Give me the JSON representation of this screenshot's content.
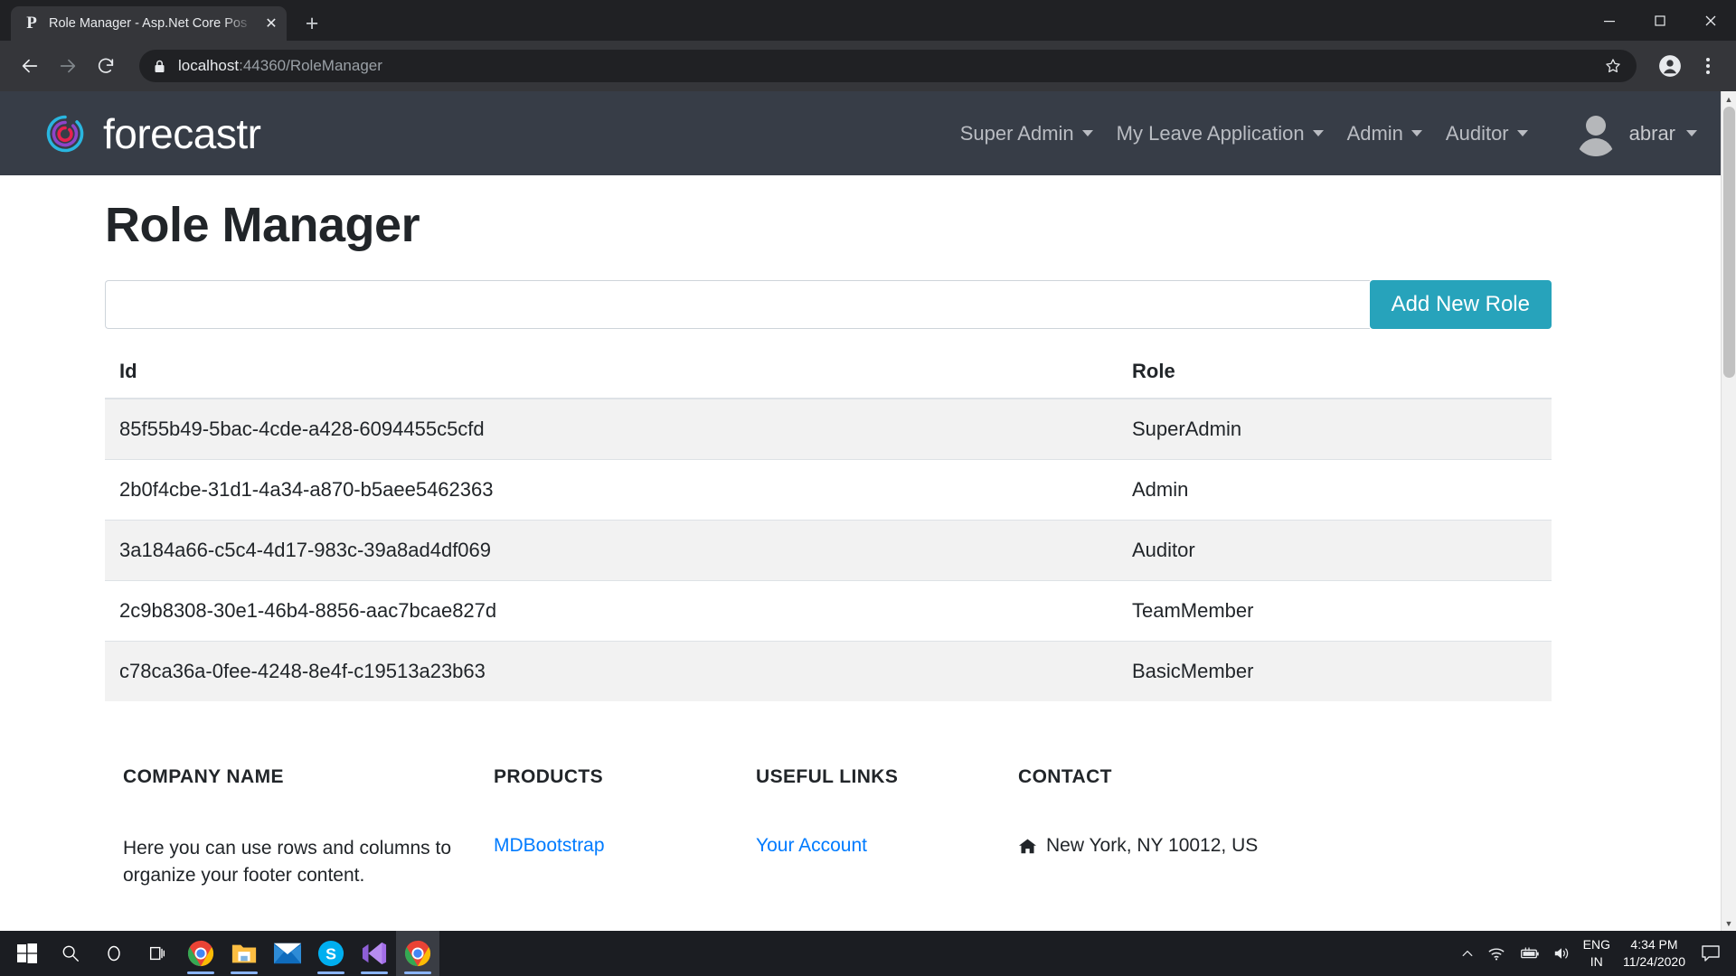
{
  "browser": {
    "tab": {
      "favicon": "P",
      "title": "Role Manager - Asp.Net Core Pos",
      "close_label": "✕"
    },
    "new_tab_label": "+",
    "window_controls": {
      "minimize": "minimize-icon",
      "maximize": "maximize-icon",
      "close": "close-icon"
    },
    "toolbar": {
      "back": "back-arrow-icon",
      "forward": "forward-arrow-icon",
      "reload": "reload-icon",
      "lock": "lock-icon",
      "url_host": "localhost",
      "url_rest": ":44360/RoleManager",
      "bookmark": "star-icon",
      "profile": "profile-avatar-icon",
      "menu": "three-dots-menu-icon"
    }
  },
  "site": {
    "brand": "forecastr",
    "nav_items": [
      {
        "label": "Super Admin"
      },
      {
        "label": "My Leave Application"
      },
      {
        "label": "Admin"
      },
      {
        "label": "Auditor"
      }
    ],
    "user": {
      "name": "abrar"
    }
  },
  "main": {
    "title": "Role Manager",
    "input": {
      "value": "",
      "placeholder": ""
    },
    "add_button": "Add New Role",
    "table": {
      "columns": [
        "Id",
        "Role"
      ],
      "rows": [
        {
          "id": "85f55b49-5bac-4cde-a428-6094455c5cfd",
          "role": "SuperAdmin"
        },
        {
          "id": "2b0f4cbe-31d1-4a34-a870-b5aee5462363",
          "role": "Admin"
        },
        {
          "id": "3a184a66-c5c4-4d17-983c-39a8ad4df069",
          "role": "Auditor"
        },
        {
          "id": "2c9b8308-30e1-46b4-8856-aac7bcae827d",
          "role": "TeamMember"
        },
        {
          "id": "c78ca36a-0fee-4248-8e4f-c19513a23b63",
          "role": "BasicMember"
        }
      ]
    }
  },
  "footer": {
    "company": {
      "heading": "COMPANY NAME",
      "text": "Here you can use rows and columns to organize your footer content."
    },
    "products": {
      "heading": "PRODUCTS",
      "links": [
        "MDBootstrap"
      ]
    },
    "useful_links": {
      "heading": "USEFUL LINKS",
      "links": [
        "Your Account"
      ]
    },
    "contact": {
      "heading": "CONTACT",
      "address": "New York, NY 10012, US",
      "address_icon": "home-icon"
    }
  },
  "taskbar": {
    "items": [
      {
        "name": "start-button",
        "icon": "windows-logo-icon"
      },
      {
        "name": "search-button",
        "icon": "search-icon"
      },
      {
        "name": "cortana-button",
        "icon": "cortana-circle-icon"
      },
      {
        "name": "task-view-button",
        "icon": "task-view-icon"
      },
      {
        "name": "chrome-taskbar-item",
        "icon": "chrome-icon"
      },
      {
        "name": "file-explorer-taskbar-item",
        "icon": "folder-icon"
      },
      {
        "name": "mail-taskbar-item",
        "icon": "mail-icon"
      },
      {
        "name": "skype-taskbar-item",
        "icon": "skype-icon"
      },
      {
        "name": "vscode-taskbar-item",
        "icon": "vscode-icon"
      },
      {
        "name": "chrome-active-taskbar-item",
        "icon": "chrome-icon"
      }
    ],
    "tray": {
      "overflow": "chevron-up-icon",
      "network": "wifi-icon",
      "battery": "battery-charging-icon",
      "volume": "speaker-icon",
      "language_line1": "ENG",
      "language_line2": "IN",
      "time": "4:34 PM",
      "date": "11/24/2020",
      "notifications": "notification-icon"
    }
  },
  "colors": {
    "navbar_bg": "#373d47",
    "accent_button": "#27a3bb",
    "link": "#007bff",
    "chrome_toolbar": "#35363a",
    "chrome_tabstrip": "#202124"
  }
}
